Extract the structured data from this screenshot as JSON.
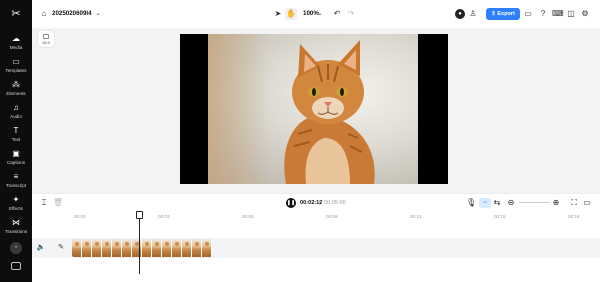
{
  "app": {
    "project_name": "2025020609l4",
    "zoom": "100%",
    "export_label": "Export"
  },
  "sidebar": {
    "items": [
      {
        "label": "Media",
        "icon": "media-icon"
      },
      {
        "label": "Templates",
        "icon": "templates-icon"
      },
      {
        "label": "Elements",
        "icon": "elements-icon"
      },
      {
        "label": "Audio",
        "icon": "audio-icon"
      },
      {
        "label": "Text",
        "icon": "text-icon"
      },
      {
        "label": "Captions",
        "icon": "captions-icon"
      },
      {
        "label": "Transcript",
        "icon": "transcript-icon"
      },
      {
        "label": "Effects",
        "icon": "effects-icon"
      },
      {
        "label": "Transitions",
        "icon": "transitions-icon"
      }
    ]
  },
  "canvas": {
    "ratio_label": "16:9"
  },
  "player": {
    "current_time": "00:02:12",
    "separator": "|",
    "total_time": "00:05:00"
  },
  "ruler": {
    "ticks": [
      "00:00",
      "00:03",
      "00:06",
      "00:09",
      "00:12",
      "00:15",
      "00:18"
    ]
  },
  "colors": {
    "accent": "#2f80ff",
    "sidebar_bg": "#0d0d0d",
    "stage_bg": "#f2f3f5"
  }
}
